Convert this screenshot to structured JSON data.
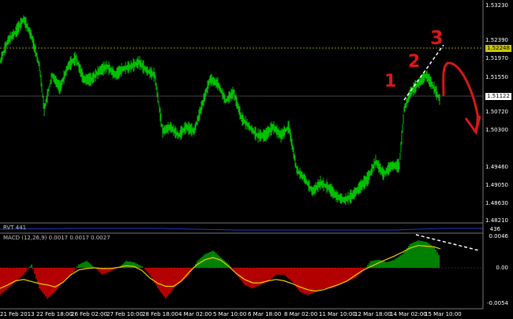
{
  "main_panel": {
    "price_axis_labels": [
      "1.53230",
      "1.52390",
      "1.51970",
      "1.51550",
      "1.50720",
      "1.50300",
      "1.49460",
      "1.49050",
      "1.48630",
      "1.48210"
    ],
    "current_price_tag": "1.52248",
    "line_price_tag": "1.51122"
  },
  "sub_panel_1": {
    "title": "RVT 441",
    "value_label": "436"
  },
  "macd_panel": {
    "title": "MACD (12,26,9) 0.0017 0.0017 0.0027",
    "axis_labels": [
      "0.0046",
      "0.00",
      "-0.0054"
    ]
  },
  "time_axis": [
    "21 Feb 2013",
    "22 Feb 18:00",
    "26 Feb 02:00",
    "27 Feb 10:00",
    "28 Feb 18:00",
    "4 Mar 02:00",
    "5 Mar 10:00",
    "6 Mar 18:00",
    "8 Mar 02:00",
    "11 Mar 10:00",
    "12 Mar 18:00",
    "14 Mar 02:00",
    "15 Mar 10:00"
  ],
  "annotations": {
    "marks": [
      "1",
      "2",
      "3"
    ]
  },
  "colors": {
    "background": "#000000",
    "candles": "#00c000",
    "yellow_level": "#c8c800",
    "macd_positive": "#00a000",
    "macd_negative": "#e00000",
    "signal_line": "#e6d200",
    "annotation": "#d81818",
    "dashed_trendline": "#ffffff"
  },
  "chart_data": {
    "type": "line",
    "title": "",
    "close_path": [
      [
        0,
        1.519
      ],
      [
        10,
        1.524
      ],
      [
        20,
        1.526
      ],
      [
        30,
        1.529
      ],
      [
        40,
        1.525
      ],
      [
        50,
        1.518
      ],
      [
        56,
        1.508
      ],
      [
        66,
        1.516
      ],
      [
        76,
        1.513
      ],
      [
        86,
        1.518
      ],
      [
        96,
        1.52
      ],
      [
        106,
        1.515
      ],
      [
        116,
        1.515
      ],
      [
        126,
        1.517
      ],
      [
        136,
        1.518
      ],
      [
        146,
        1.516
      ],
      [
        156,
        1.5175
      ],
      [
        166,
        1.518
      ],
      [
        176,
        1.519
      ],
      [
        186,
        1.517
      ],
      [
        196,
        1.516
      ],
      [
        206,
        1.503
      ],
      [
        216,
        1.504
      ],
      [
        226,
        1.502
      ],
      [
        236,
        1.504
      ],
      [
        246,
        1.503
      ],
      [
        256,
        1.509
      ],
      [
        266,
        1.515
      ],
      [
        276,
        1.514
      ],
      [
        286,
        1.51
      ],
      [
        296,
        1.512
      ],
      [
        306,
        1.506
      ],
      [
        316,
        1.504
      ],
      [
        326,
        1.502
      ],
      [
        336,
        1.502
      ],
      [
        346,
        1.504
      ],
      [
        356,
        1.502
      ],
      [
        366,
        1.504
      ],
      [
        376,
        1.494
      ],
      [
        386,
        1.492
      ],
      [
        396,
        1.489
      ],
      [
        406,
        1.491
      ],
      [
        416,
        1.49
      ],
      [
        426,
        1.488
      ],
      [
        436,
        1.487
      ],
      [
        446,
        1.488
      ],
      [
        456,
        1.49
      ],
      [
        466,
        1.492
      ],
      [
        476,
        1.496
      ],
      [
        486,
        1.493
      ],
      [
        496,
        1.495
      ],
      [
        506,
        1.495
      ],
      [
        512,
        1.508
      ],
      [
        520,
        1.512
      ],
      [
        530,
        1.514
      ],
      [
        540,
        1.516
      ],
      [
        550,
        1.513
      ],
      [
        558,
        1.51
      ]
    ],
    "macd_histogram": [
      [
        0,
        -0.004
      ],
      [
        10,
        -0.003
      ],
      [
        20,
        -0.002
      ],
      [
        30,
        -0.001
      ],
      [
        40,
        0.0005
      ],
      [
        50,
        -0.003
      ],
      [
        60,
        -0.0045
      ],
      [
        70,
        -0.0035
      ],
      [
        80,
        -0.002
      ],
      [
        90,
        -0.001
      ],
      [
        100,
        0.0005
      ],
      [
        110,
        0.001
      ],
      [
        120,
        0.0
      ],
      [
        130,
        -0.001
      ],
      [
        140,
        -0.0005
      ],
      [
        150,
        0.0
      ],
      [
        160,
        0.001
      ],
      [
        170,
        0.0008
      ],
      [
        180,
        0.0002
      ],
      [
        190,
        -0.001
      ],
      [
        200,
        -0.003
      ],
      [
        210,
        -0.0045
      ],
      [
        220,
        -0.003
      ],
      [
        230,
        -0.002
      ],
      [
        240,
        -0.001
      ],
      [
        250,
        0.001
      ],
      [
        260,
        0.002
      ],
      [
        270,
        0.0025
      ],
      [
        280,
        0.0015
      ],
      [
        290,
        0.0005
      ],
      [
        300,
        -0.001
      ],
      [
        310,
        -0.0025
      ],
      [
        320,
        -0.003
      ],
      [
        330,
        -0.0025
      ],
      [
        340,
        -0.002
      ],
      [
        350,
        -0.001
      ],
      [
        360,
        -0.001
      ],
      [
        370,
        -0.002
      ],
      [
        380,
        -0.0035
      ],
      [
        390,
        -0.004
      ],
      [
        400,
        -0.0035
      ],
      [
        410,
        -0.003
      ],
      [
        420,
        -0.003
      ],
      [
        430,
        -0.0025
      ],
      [
        440,
        -0.002
      ],
      [
        450,
        -0.0015
      ],
      [
        460,
        -0.0005
      ],
      [
        470,
        0.001
      ],
      [
        480,
        0.0012
      ],
      [
        490,
        0.0008
      ],
      [
        500,
        0.0012
      ],
      [
        510,
        0.002
      ],
      [
        520,
        0.0035
      ],
      [
        530,
        0.004
      ],
      [
        540,
        0.0038
      ],
      [
        550,
        0.003
      ],
      [
        558,
        0.0015
      ]
    ]
  }
}
